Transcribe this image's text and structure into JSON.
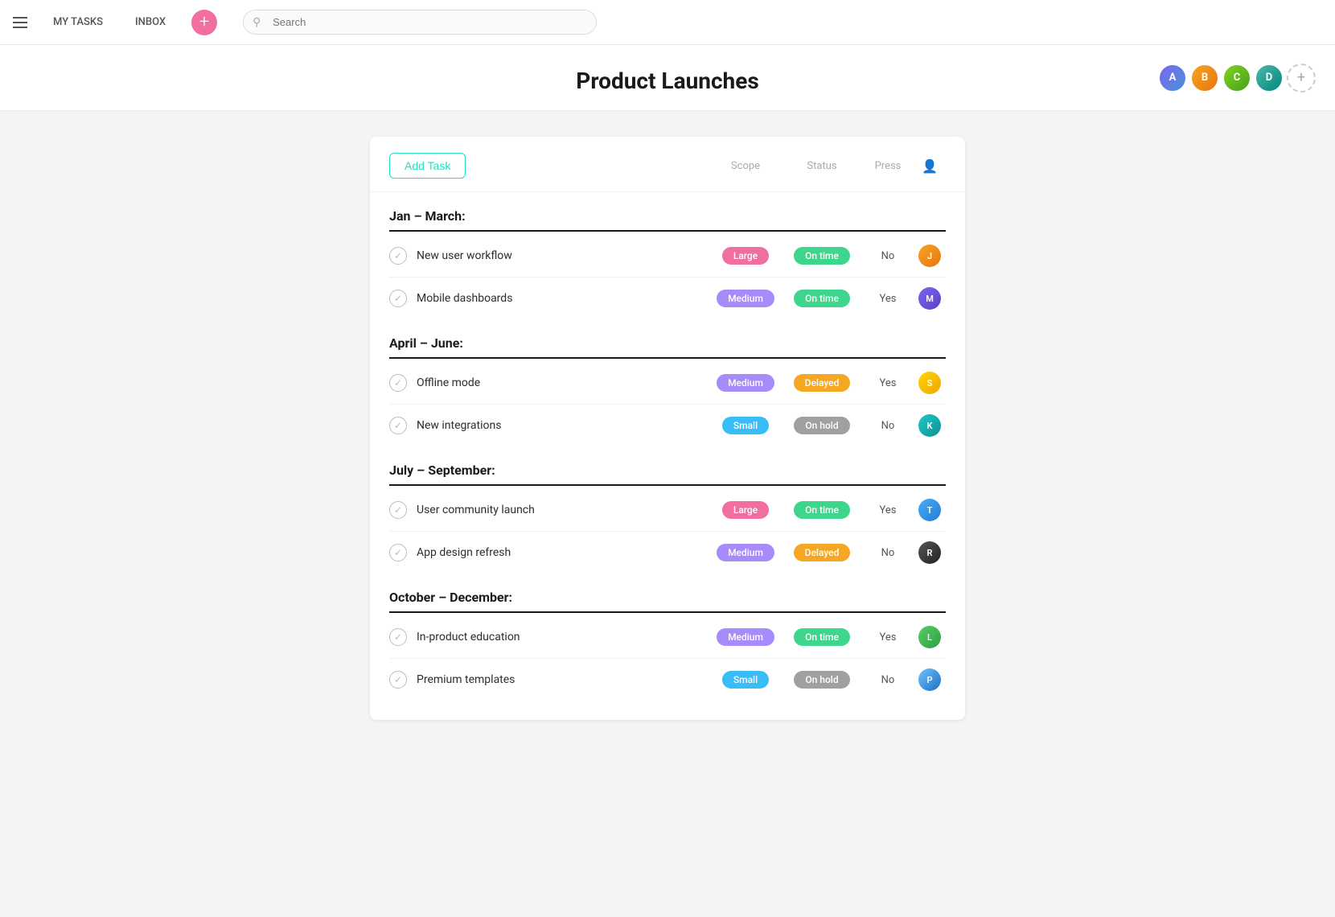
{
  "nav": {
    "my_tasks": "MY TASKS",
    "inbox": "INBOX"
  },
  "search": {
    "placeholder": "Search"
  },
  "page": {
    "title": "Product Launches"
  },
  "avatars": [
    {
      "id": "av1",
      "initials": "A",
      "color": "av1"
    },
    {
      "id": "av2",
      "initials": "B",
      "color": "av2"
    },
    {
      "id": "av3",
      "initials": "C",
      "color": "av3"
    },
    {
      "id": "av4",
      "initials": "D",
      "color": "av4"
    }
  ],
  "card": {
    "add_task_label": "Add Task",
    "col_scope": "Scope",
    "col_status": "Status",
    "col_press": "Press",
    "sections": [
      {
        "id": "jan-march",
        "title": "Jan – March:",
        "tasks": [
          {
            "name": "New user workflow",
            "scope": "Large",
            "scope_class": "badge-large",
            "status": "On time",
            "status_class": "status-ontime",
            "press": "No",
            "avatar_class": "tav-orange",
            "initials": "J"
          },
          {
            "name": "Mobile dashboards",
            "scope": "Medium",
            "scope_class": "badge-medium",
            "status": "On time",
            "status_class": "status-ontime",
            "press": "Yes",
            "avatar_class": "tav-purple",
            "initials": "M"
          }
        ]
      },
      {
        "id": "april-june",
        "title": "April – June:",
        "tasks": [
          {
            "name": "Offline mode",
            "scope": "Medium",
            "scope_class": "badge-medium",
            "status": "Delayed",
            "status_class": "status-delayed",
            "press": "Yes",
            "avatar_class": "tav-yellow",
            "initials": "S"
          },
          {
            "name": "New integrations",
            "scope": "Small",
            "scope_class": "badge-small",
            "status": "On hold",
            "status_class": "status-onhold",
            "press": "No",
            "avatar_class": "tav-teal",
            "initials": "K"
          }
        ]
      },
      {
        "id": "july-september",
        "title": "July – September:",
        "tasks": [
          {
            "name": "User community launch",
            "scope": "Large",
            "scope_class": "badge-large",
            "status": "On time",
            "status_class": "status-ontime",
            "press": "Yes",
            "avatar_class": "tav-blue",
            "initials": "T"
          },
          {
            "name": "App design refresh",
            "scope": "Medium",
            "scope_class": "badge-medium",
            "status": "Delayed",
            "status_class": "status-delayed",
            "press": "No",
            "avatar_class": "tav-dark",
            "initials": "R"
          }
        ]
      },
      {
        "id": "october-december",
        "title": "October – December:",
        "tasks": [
          {
            "name": "In-product education",
            "scope": "Medium",
            "scope_class": "badge-medium",
            "status": "On time",
            "status_class": "status-ontime",
            "press": "Yes",
            "avatar_class": "tav-green",
            "initials": "L"
          },
          {
            "name": "Premium templates",
            "scope": "Small",
            "scope_class": "badge-small",
            "status": "On hold",
            "status_class": "status-onhold",
            "press": "No",
            "avatar_class": "tav-lightblue",
            "initials": "P"
          }
        ]
      }
    ]
  }
}
